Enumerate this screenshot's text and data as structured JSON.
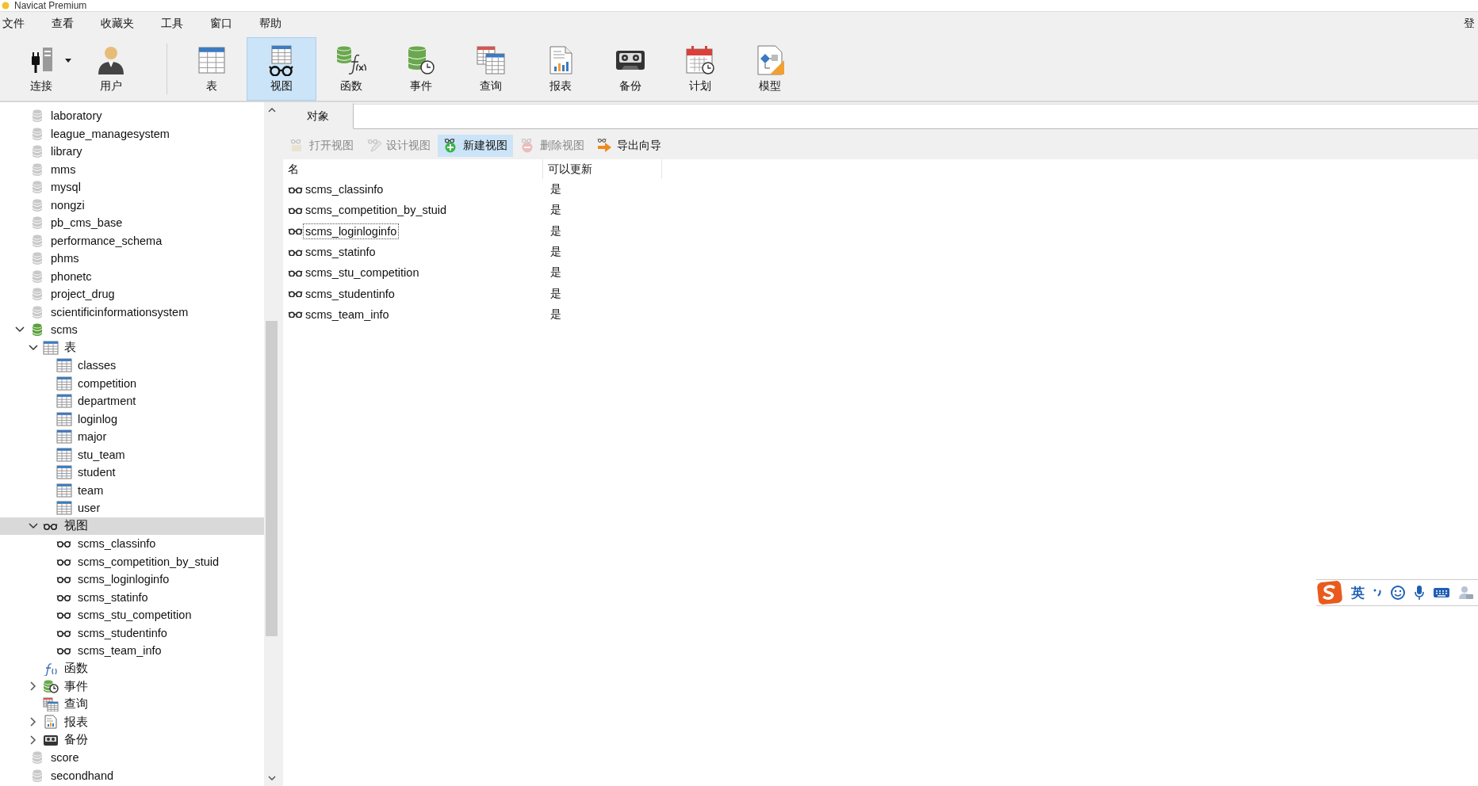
{
  "window": {
    "title": "Navicat Premium"
  },
  "menu": [
    {
      "label": "文件"
    },
    {
      "label": "查看"
    },
    {
      "label": "收藏夹"
    },
    {
      "label": "工具"
    },
    {
      "label": "窗口"
    },
    {
      "label": "帮助"
    }
  ],
  "account_menu": "登",
  "toolbar_groups": [
    [
      {
        "label": "连接",
        "kind": "connection",
        "selected": false,
        "dropdown": true
      },
      {
        "label": "用户",
        "kind": "user",
        "selected": false,
        "dropdown": false
      }
    ],
    [
      {
        "label": "表",
        "kind": "table",
        "selected": false,
        "dropdown": false
      },
      {
        "label": "视图",
        "kind": "view",
        "selected": true,
        "dropdown": false
      },
      {
        "label": "函数",
        "kind": "function",
        "selected": false,
        "dropdown": false
      },
      {
        "label": "事件",
        "kind": "event",
        "selected": false,
        "dropdown": false
      },
      {
        "label": "查询",
        "kind": "query",
        "selected": false,
        "dropdown": false
      },
      {
        "label": "报表",
        "kind": "report",
        "selected": false,
        "dropdown": false
      },
      {
        "label": "备份",
        "kind": "backup",
        "selected": false,
        "dropdown": false
      },
      {
        "label": "计划",
        "kind": "schedule",
        "selected": false,
        "dropdown": false
      },
      {
        "label": "模型",
        "kind": "model",
        "selected": false,
        "dropdown": false
      }
    ]
  ],
  "sidebar": {
    "tree": [
      {
        "label": "laboratory",
        "kind": "database",
        "open": false,
        "selected": false
      },
      {
        "label": "league_managesystem",
        "kind": "database",
        "open": false,
        "selected": false
      },
      {
        "label": "library",
        "kind": "database",
        "open": false,
        "selected": false
      },
      {
        "label": "mms",
        "kind": "database",
        "open": false,
        "selected": false
      },
      {
        "label": "mysql",
        "kind": "database",
        "open": false,
        "selected": false
      },
      {
        "label": "nongzi",
        "kind": "database",
        "open": false,
        "selected": false
      },
      {
        "label": "pb_cms_base",
        "kind": "database",
        "open": false,
        "selected": false
      },
      {
        "label": "performance_schema",
        "kind": "database",
        "open": false,
        "selected": false
      },
      {
        "label": "phms",
        "kind": "database",
        "open": false,
        "selected": false
      },
      {
        "label": "phonetc",
        "kind": "database",
        "open": false,
        "selected": false
      },
      {
        "label": "project_drug",
        "kind": "database",
        "open": false,
        "selected": false
      },
      {
        "label": "scientificinformationsystem",
        "kind": "database",
        "open": false,
        "selected": false
      },
      {
        "label": "scms",
        "kind": "database",
        "open": true,
        "expanded": true,
        "selected": false,
        "children": [
          {
            "label": "表",
            "kind": "table-group",
            "expanded": true,
            "selected": false,
            "children": [
              {
                "label": "classes",
                "kind": "table",
                "selected": false
              },
              {
                "label": "competition",
                "kind": "table",
                "selected": false
              },
              {
                "label": "department",
                "kind": "table",
                "selected": false
              },
              {
                "label": "loginlog",
                "kind": "table",
                "selected": false
              },
              {
                "label": "major",
                "kind": "table",
                "selected": false
              },
              {
                "label": "stu_team",
                "kind": "table",
                "selected": false
              },
              {
                "label": "student",
                "kind": "table",
                "selected": false
              },
              {
                "label": "team",
                "kind": "table",
                "selected": false
              },
              {
                "label": "user",
                "kind": "table",
                "selected": false
              }
            ]
          },
          {
            "label": "视图",
            "kind": "view-group",
            "expanded": true,
            "selected": true,
            "children": [
              {
                "label": "scms_classinfo",
                "kind": "view",
                "selected": false
              },
              {
                "label": "scms_competition_by_stuid",
                "kind": "view",
                "selected": false
              },
              {
                "label": "scms_loginloginfo",
                "kind": "view",
                "selected": false
              },
              {
                "label": "scms_statinfo",
                "kind": "view",
                "selected": false
              },
              {
                "label": "scms_stu_competition",
                "kind": "view",
                "selected": false
              },
              {
                "label": "scms_studentinfo",
                "kind": "view",
                "selected": false
              },
              {
                "label": "scms_team_info",
                "kind": "view",
                "selected": false
              }
            ]
          },
          {
            "label": "函数",
            "kind": "function-group",
            "selected": false
          },
          {
            "label": "事件",
            "kind": "event-group",
            "expanded": false,
            "selected": false
          },
          {
            "label": "查询",
            "kind": "query-group",
            "selected": false
          },
          {
            "label": "报表",
            "kind": "report-group",
            "expanded": false,
            "selected": false
          },
          {
            "label": "备份",
            "kind": "backup-group",
            "expanded": false,
            "selected": false
          }
        ]
      },
      {
        "label": "score",
        "kind": "database",
        "open": false,
        "selected": false
      },
      {
        "label": "secondhand",
        "kind": "database",
        "open": false,
        "selected": false
      }
    ]
  },
  "object_panel": {
    "tabs": [
      {
        "label": "对象",
        "selected": true
      }
    ],
    "actions": [
      {
        "label": "打开视图",
        "kind": "open",
        "disabled": true,
        "hovered": false
      },
      {
        "label": "设计视图",
        "kind": "design",
        "disabled": true,
        "hovered": false
      },
      {
        "label": "新建视图",
        "kind": "new",
        "disabled": false,
        "hovered": true
      },
      {
        "label": "删除视图",
        "kind": "delete",
        "disabled": true,
        "hovered": false
      },
      {
        "label": "导出向导",
        "kind": "export",
        "disabled": false,
        "hovered": false
      }
    ],
    "table": {
      "columns": [
        "名",
        "可以更新"
      ],
      "rows": [
        {
          "name": "scms_classinfo",
          "updatable": "是",
          "focused": false
        },
        {
          "name": "scms_competition_by_stuid",
          "updatable": "是",
          "focused": false
        },
        {
          "name": "scms_loginloginfo",
          "updatable": "是",
          "focused": true
        },
        {
          "name": "scms_statinfo",
          "updatable": "是",
          "focused": false
        },
        {
          "name": "scms_stu_competition",
          "updatable": "是",
          "focused": false
        },
        {
          "name": "scms_studentinfo",
          "updatable": "是",
          "focused": false
        },
        {
          "name": "scms_team_info",
          "updatable": "是",
          "focused": false
        }
      ]
    }
  },
  "ime_bar": {
    "mode": "英"
  }
}
